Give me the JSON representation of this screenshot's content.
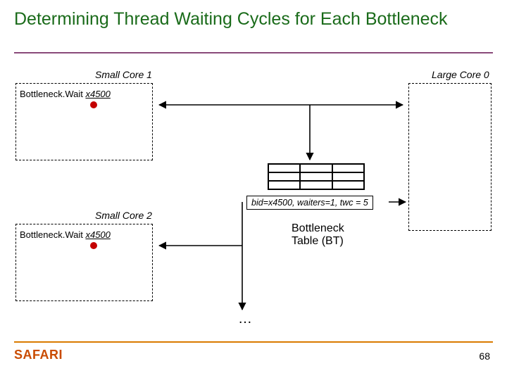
{
  "title": "Determining Thread Waiting Cycles for Each Bottleneck",
  "cores": {
    "small1": "Small Core 1",
    "small2": "Small Core 2",
    "large0": "Large Core 0"
  },
  "bwait1_prefix": "Bottleneck.Wait",
  "bwait1_arg": "x4500",
  "bwait2_prefix": "Bottleneck.Wait",
  "bwait2_arg": "x4500",
  "bt_row": "bid=x4500, waiters=1, twc = 5",
  "bt_caption_l1": "Bottleneck",
  "bt_caption_l2": "Table (BT)",
  "ellipsis": "…",
  "logo": "SAFARI",
  "page": "68"
}
